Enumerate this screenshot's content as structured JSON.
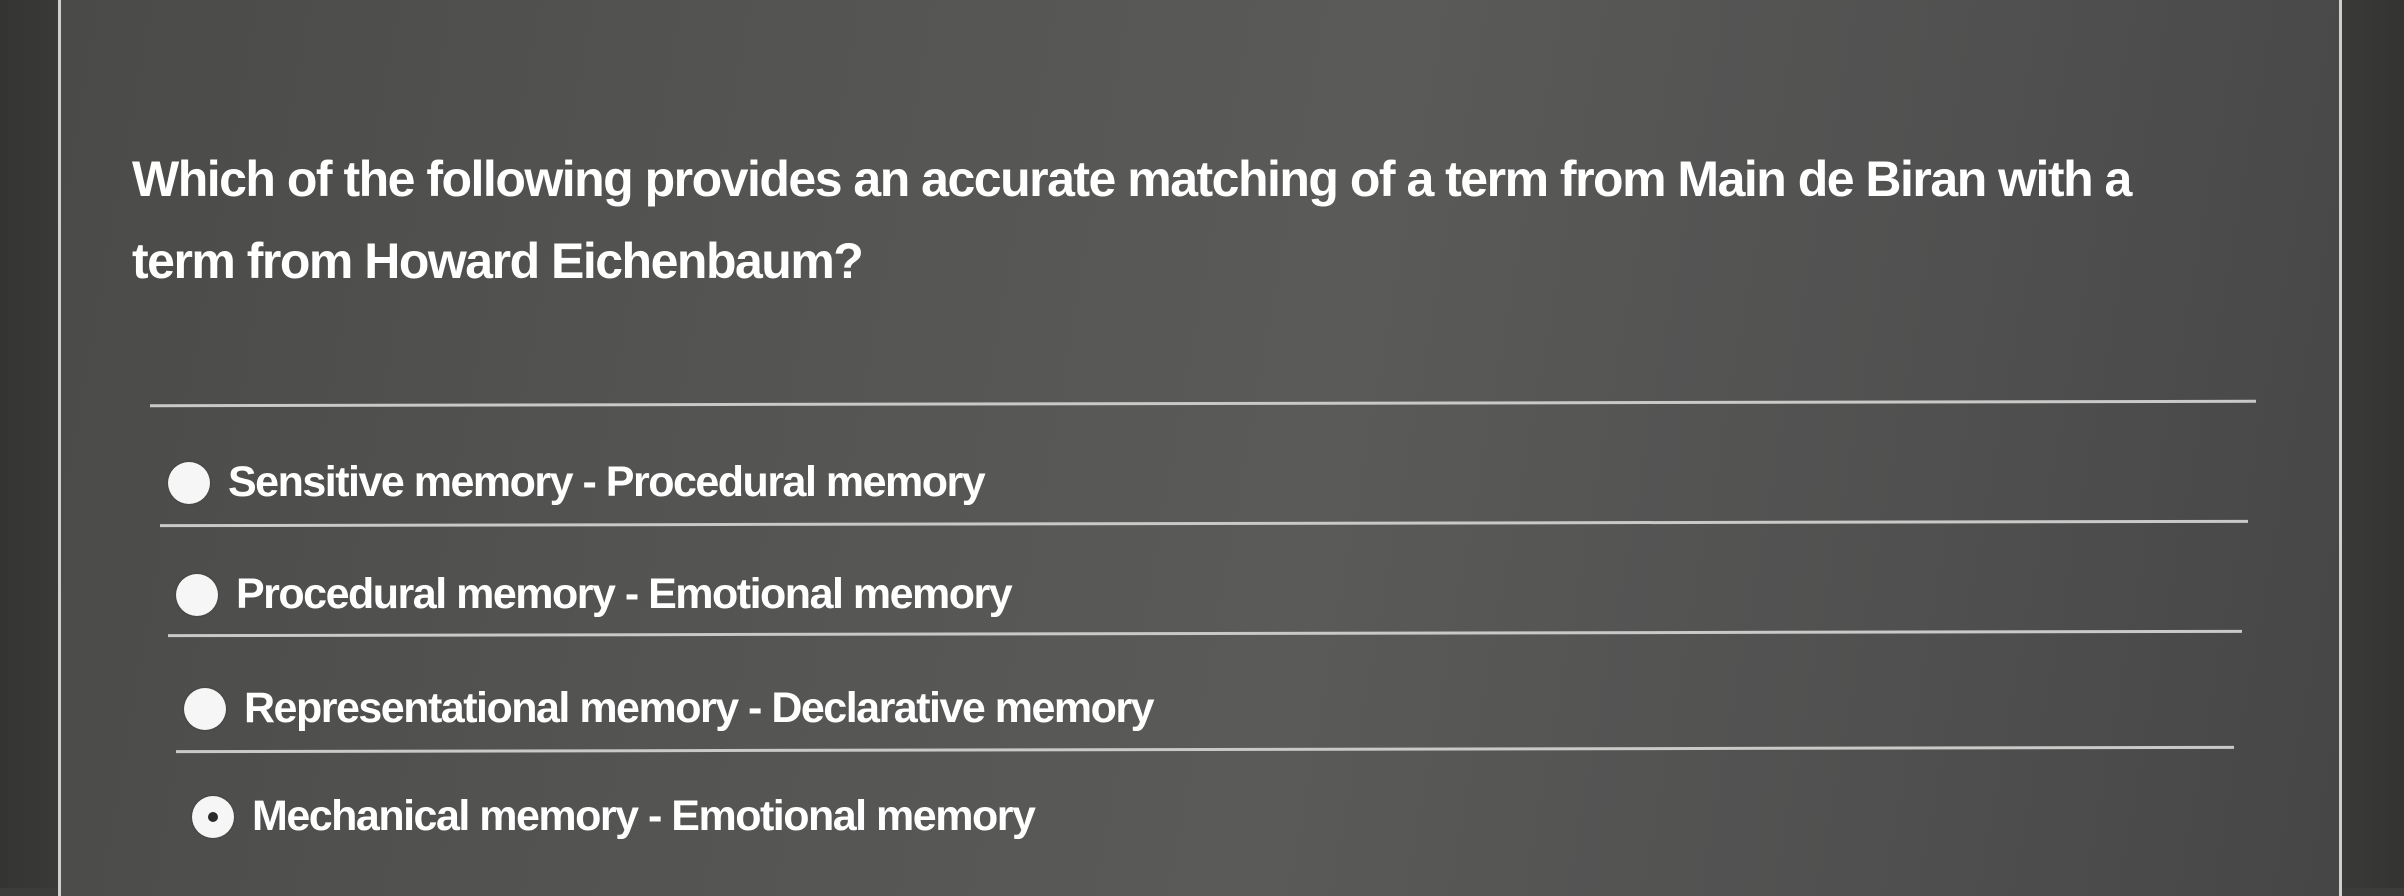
{
  "question": {
    "line1": "Which of the following provides an accurate matching of a term from Main de Biran with a",
    "line2": "term from Howard Eichenbaum?"
  },
  "options": [
    {
      "label": "Sensitive memory - Procedural memory",
      "selected": false
    },
    {
      "label": "Procedural memory - Emotional memory",
      "selected": false
    },
    {
      "label": "Representational memory - Declarative memory",
      "selected": false
    },
    {
      "label": "Mechanical memory - Emotional memory",
      "selected": true
    }
  ]
}
